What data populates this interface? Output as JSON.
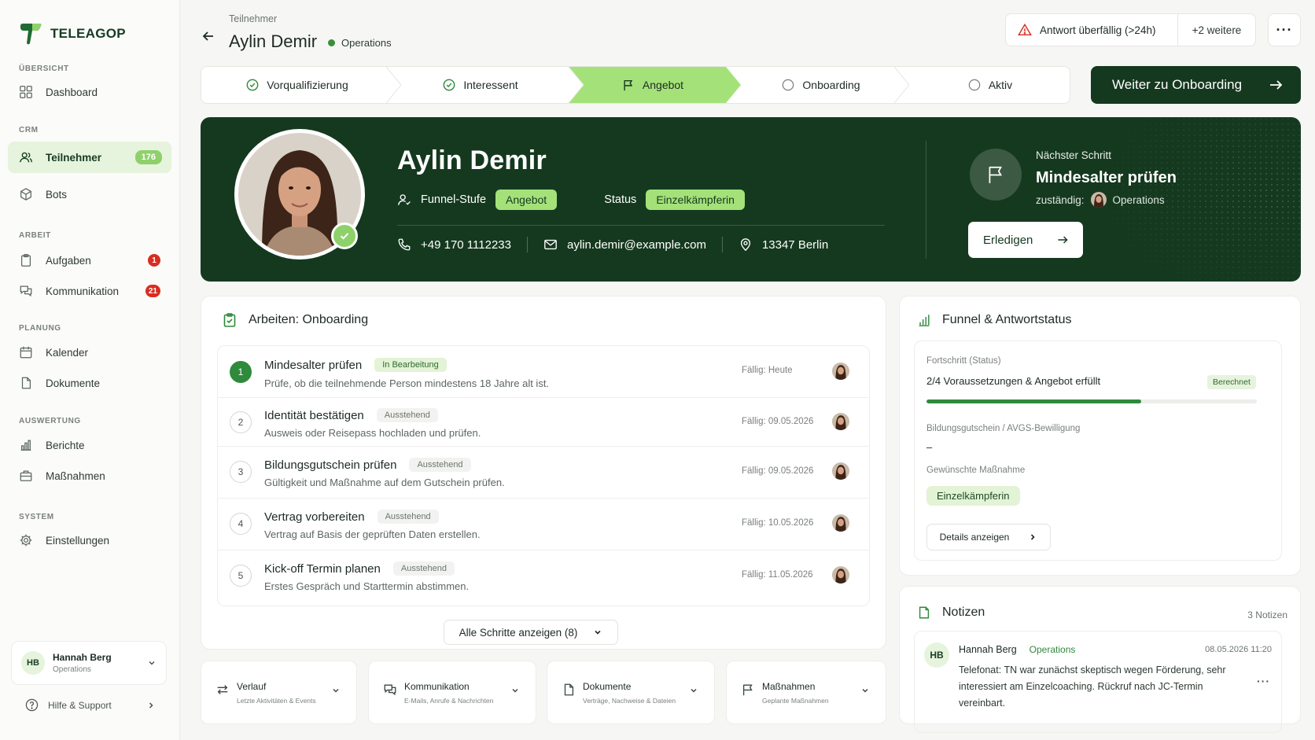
{
  "app": {
    "name": "TELEAGOP"
  },
  "sidebar": {
    "sections": [
      {
        "label": "ÜBERSICHT"
      },
      {
        "label": "CRM"
      },
      {
        "label": "ARBEIT"
      },
      {
        "label": "PLANUNG"
      },
      {
        "label": "AUSWERTUNG"
      },
      {
        "label": "SYSTEM"
      }
    ],
    "items": [
      {
        "label": "Dashboard",
        "icon": "grid-icon"
      },
      {
        "label": "Teilnehmer",
        "icon": "users-icon",
        "badge": "176",
        "active": true
      },
      {
        "label": "Bots",
        "icon": "bot-icon"
      },
      {
        "label": "Aufgaben",
        "icon": "clipboard-icon",
        "badge": "1"
      },
      {
        "label": "Kommunikation",
        "icon": "chat-icon",
        "badge": "21"
      },
      {
        "label": "Kalender",
        "icon": "calendar-icon"
      },
      {
        "label": "Dokumente",
        "icon": "document-icon"
      },
      {
        "label": "Berichte",
        "icon": "bar-chart-icon"
      },
      {
        "label": "Maßnahmen",
        "icon": "briefcase-icon"
      },
      {
        "label": "Einstellungen",
        "icon": "gear-icon"
      }
    ],
    "user": {
      "initials": "HB",
      "name": "Hannah Berg",
      "role": "Operations"
    },
    "help": "Hilfe & Support"
  },
  "header": {
    "breadcrumb": "Teilnehmer",
    "title": "Aylin Demir",
    "status": "Operations",
    "alert": "Antwort überfällig (>24h)",
    "alert_more": "+2 weitere",
    "more": "···"
  },
  "stepper": {
    "steps": [
      {
        "label": "Vorqualifizierung",
        "state": "done"
      },
      {
        "label": "Interessent",
        "state": "done"
      },
      {
        "label": "Angebot",
        "state": "active"
      },
      {
        "label": "Onboarding",
        "state": "open"
      },
      {
        "label": "Aktiv",
        "state": "open"
      }
    ],
    "next_button": "Weiter zu Onboarding"
  },
  "profile": {
    "name": "Aylin Demir",
    "funnel_label": "Funnel-Stufe",
    "funnel_value": "Angebot",
    "status_label": "Status",
    "status_value": "Einzelkämpferin",
    "phone": "+49 170 1112233",
    "email": "aylin.demir@example.com",
    "location": "13347 Berlin",
    "next_step_label": "Nächster Schritt",
    "next_step_title": "Mindesalter prüfen",
    "responsible_label": "zuständig:",
    "responsible_value": "Operations",
    "done_button": "Erledigen"
  },
  "tasks": {
    "title": "Arbeiten: Onboarding",
    "items": [
      {
        "num": "1",
        "title": "Mindesalter prüfen",
        "tag": "In Bearbeitung",
        "desc": "Prüfe, ob die teilnehmende Person mindestens 18 Jahre alt ist.",
        "due": "Fällig: Heute"
      },
      {
        "num": "2",
        "title": "Identität bestätigen",
        "tag": "Ausstehend",
        "desc": "Ausweis oder Reisepass hochladen und prüfen.",
        "due": "Fällig: 09.05.2026"
      },
      {
        "num": "3",
        "title": "Bildungsgutschein prüfen",
        "tag": "Ausstehend",
        "desc": "Gültigkeit und Maßnahme auf dem Gutschein prüfen.",
        "due": "Fällig: 09.05.2026"
      },
      {
        "num": "4",
        "title": "Vertrag vorbereiten",
        "tag": "Ausstehend",
        "desc": "Vertrag auf Basis der geprüften Daten erstellen.",
        "due": "Fällig: 10.05.2026"
      },
      {
        "num": "5",
        "title": "Kick-off Termin planen",
        "tag": "Ausstehend",
        "desc": "Erstes Gespräch und Starttermin abstimmen.",
        "due": "Fällig: 11.05.2026"
      }
    ],
    "show_all": "Alle Schritte anzeigen (8)"
  },
  "bottom_cards": [
    {
      "title": "Verlauf",
      "subtitle": "Letzte Aktivitäten & Events",
      "icon": "swap-arrows-icon"
    },
    {
      "title": "Kommunikation",
      "subtitle": "E-Mails, Anrufe & Nachrichten",
      "icon": "chat-icon"
    },
    {
      "title": "Dokumente",
      "subtitle": "Verträge, Nachweise & Dateien",
      "icon": "document-icon"
    },
    {
      "title": "Maßnahmen",
      "subtitle": "Geplante Maßnahmen",
      "icon": "flag-icon"
    }
  ],
  "funnel": {
    "title": "Funnel & Antwortstatus",
    "progress_label": "Fortschritt (Status)",
    "progress_value": "2/4 Voraussetzungen & Angebot erfüllt",
    "progress_fraction": 0.65,
    "calc_tag": "Berechnet",
    "voucher_label": "Bildungsgutschein / AVGS-Bewilligung",
    "voucher_value": "–",
    "measure_label": "Gewünschte Maßnahme",
    "measure_value": "Einzelkämpferin",
    "details_button": "Details anzeigen"
  },
  "notes": {
    "title": "Notizen",
    "count": "3 Notizen",
    "items": [
      {
        "initials": "HB",
        "author": "Hannah Berg",
        "role": "Operations",
        "date": "08.05.2026 11:20",
        "text": "Telefonat: TN war zunächst skeptisch wegen Förderung, sehr interessiert am Einzelcoaching. Rückruf nach JC-Termin vereinbart."
      }
    ]
  },
  "colors": {
    "brand_dark": "#15391f",
    "accent": "#a4e279",
    "success": "#2f8a3c",
    "danger": "#d92d20"
  }
}
